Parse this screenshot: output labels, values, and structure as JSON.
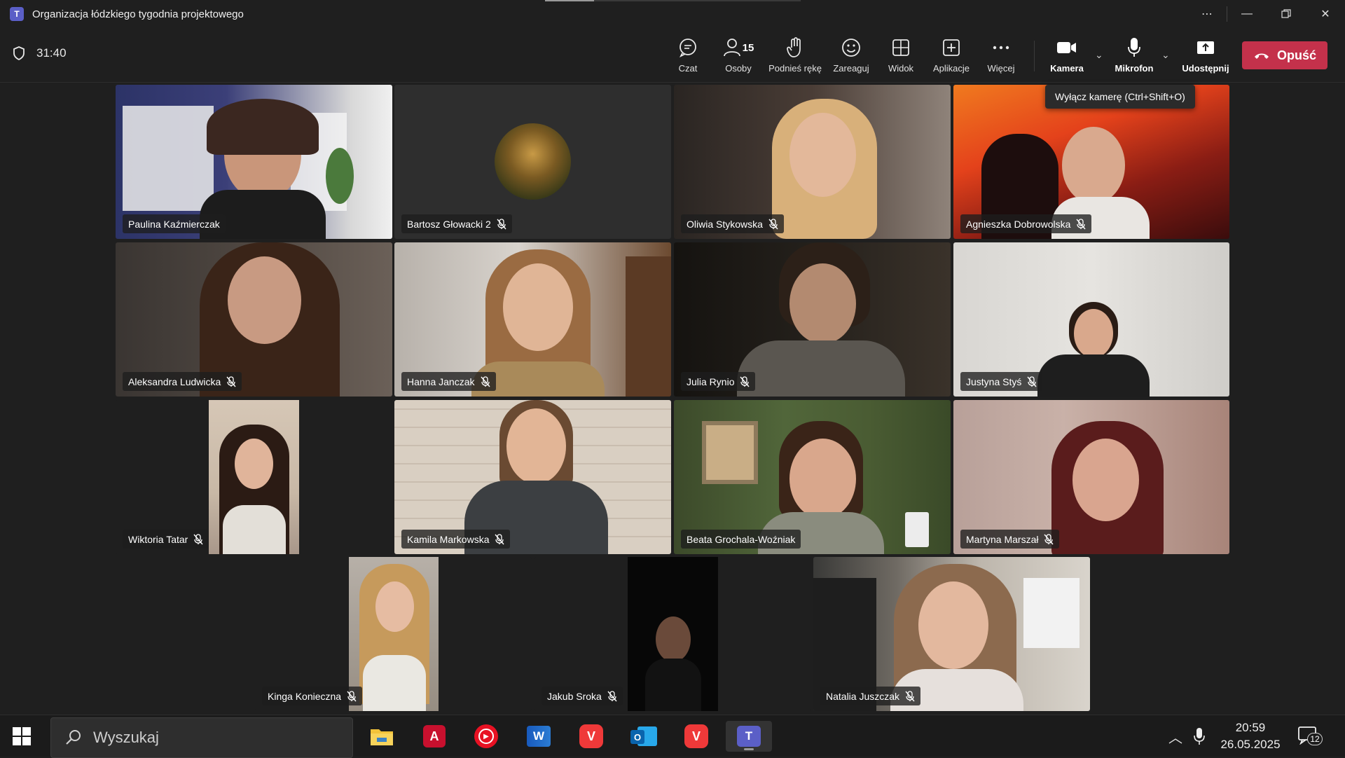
{
  "window": {
    "title": "Organizacja łódzkiego tygodnia projektowego"
  },
  "toolbar": {
    "timer": "31:40",
    "chat_label": "Czat",
    "people_label": "Osoby",
    "people_count": "15",
    "raise_hand_label": "Podnieś rękę",
    "react_label": "Zareaguj",
    "view_label": "Widok",
    "apps_label": "Aplikacje",
    "more_label": "Więcej",
    "camera_label": "Kamera",
    "mic_label": "Mikrofon",
    "share_label": "Udostępnij",
    "leave_label": "Opuść"
  },
  "tooltip": "Wyłącz kamerę (Ctrl+Shift+O)",
  "participants": [
    {
      "name": "Paulina Kaźmierczak",
      "muted": false
    },
    {
      "name": "Bartosz Głowacki 2",
      "muted": true
    },
    {
      "name": "Oliwia Stykowska",
      "muted": true
    },
    {
      "name": "Agnieszka Dobrowolska",
      "muted": true
    },
    {
      "name": "Aleksandra Ludwicka",
      "muted": true
    },
    {
      "name": "Hanna Janczak",
      "muted": true
    },
    {
      "name": "Julia Rynio",
      "muted": true
    },
    {
      "name": "Justyna Styś",
      "muted": true
    },
    {
      "name": "Wiktoria Tatar",
      "muted": true
    },
    {
      "name": "Kamila Markowska",
      "muted": true
    },
    {
      "name": "Beata Grochala-Woźniak",
      "muted": false
    },
    {
      "name": "Martyna Marszał",
      "muted": true
    },
    {
      "name": "Kinga Konieczna",
      "muted": true
    },
    {
      "name": "Jakub Sroka",
      "muted": true
    },
    {
      "name": "Natalia Juszczak",
      "muted": true
    }
  ],
  "taskbar": {
    "search_placeholder": "Wyszukaj",
    "time": "20:59",
    "date": "26.05.2025",
    "notification_count": "12"
  }
}
